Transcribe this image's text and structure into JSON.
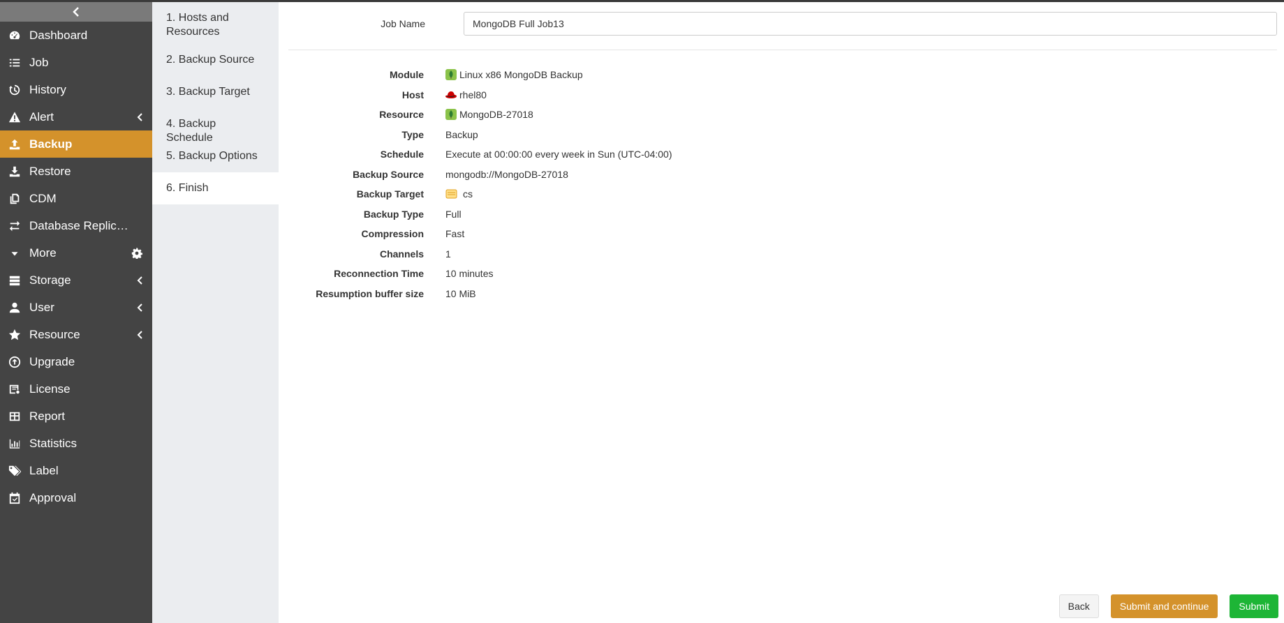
{
  "sidebar": {
    "items": [
      {
        "label": "Dashboard",
        "icon": "dashboard-icon"
      },
      {
        "label": "Job",
        "icon": "list-icon"
      },
      {
        "label": "History",
        "icon": "history-icon"
      },
      {
        "label": "Alert",
        "icon": "warning-icon"
      },
      {
        "label": "Backup",
        "icon": "upload-icon"
      },
      {
        "label": "Restore",
        "icon": "download-icon"
      },
      {
        "label": "CDM",
        "icon": "copy-icon"
      },
      {
        "label": "Database Replication",
        "icon": "exchange-icon"
      },
      {
        "label": "More",
        "icon": "caret-down-icon"
      },
      {
        "label": "Storage",
        "icon": "server-icon"
      },
      {
        "label": "User",
        "icon": "user-icon"
      },
      {
        "label": "Resource",
        "icon": "star-icon"
      },
      {
        "label": "Upgrade",
        "icon": "arrow-up-circle-icon"
      },
      {
        "label": "License",
        "icon": "license-icon"
      },
      {
        "label": "Report",
        "icon": "table-icon"
      },
      {
        "label": "Statistics",
        "icon": "bar-chart-icon"
      },
      {
        "label": "Label",
        "icon": "tags-icon"
      },
      {
        "label": "Approval",
        "icon": "calendar-check-icon"
      }
    ],
    "active": "Backup"
  },
  "steps": [
    "1. Hosts and Resources",
    "2. Backup Source",
    "3. Backup Target",
    "4. Backup Schedule",
    "5. Backup Options",
    "6. Finish"
  ],
  "job": {
    "name_label": "Job Name",
    "name_value": "MongoDB Full Job13"
  },
  "details": [
    {
      "label": "Module",
      "value": "Linux x86 MongoDB Backup",
      "icon": "mongodb-leaf-icon"
    },
    {
      "label": "Host",
      "value": "rhel80",
      "icon": "redhat-icon"
    },
    {
      "label": "Resource",
      "value": "MongoDB-27018",
      "icon": "mongodb-leaf-icon"
    },
    {
      "label": "Type",
      "value": "Backup"
    },
    {
      "label": "Schedule",
      "value": "Execute at 00:00:00 every week in Sun (UTC-04:00)"
    },
    {
      "label": "Backup Source",
      "value": "mongodb://MongoDB-27018"
    },
    {
      "label": "Backup Target",
      "value": "cs",
      "icon": "storage-pool-icon"
    },
    {
      "label": "Backup Type",
      "value": "Full"
    },
    {
      "label": "Compression",
      "value": "Fast"
    },
    {
      "label": "Channels",
      "value": "1"
    },
    {
      "label": "Reconnection Time",
      "value": "10 minutes"
    },
    {
      "label": "Resumption buffer size",
      "value": "10 MiB"
    }
  ],
  "buttons": {
    "back": "Back",
    "submit_continue": "Submit and continue",
    "submit": "Submit"
  },
  "colors": {
    "sidebar_bg": "#444444",
    "accent": "#d4922b",
    "submit": "#1db536"
  }
}
